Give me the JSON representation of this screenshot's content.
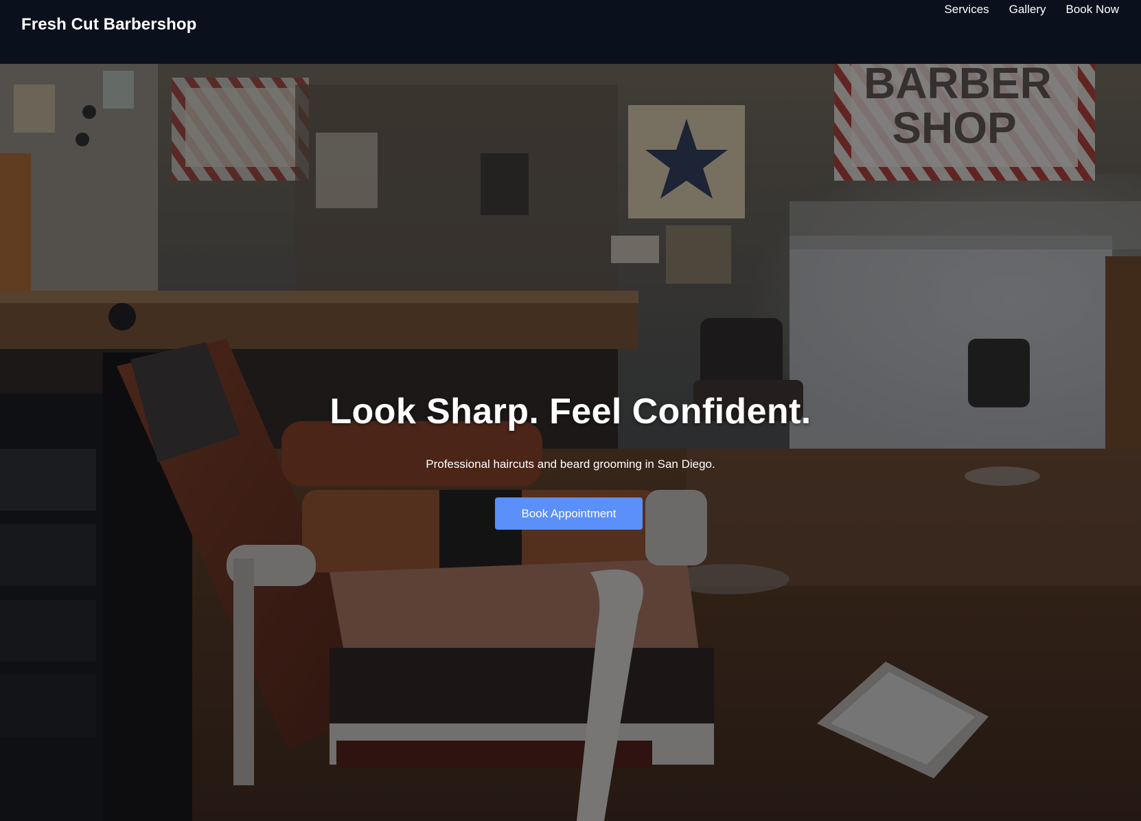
{
  "header": {
    "brand": "Fresh Cut Barbershop",
    "nav": [
      "Services",
      "Gallery",
      "Book Now"
    ]
  },
  "hero": {
    "title": "Look Sharp. Feel Confident.",
    "subtitle": "Professional haircuts and beard grooming in San Diego.",
    "cta_label": "Book Appointment",
    "background": "barbershop interior with barber chairs",
    "wall_sign_text": [
      "BARBER",
      "SHOP"
    ]
  },
  "colors": {
    "header_bg": "#0b111c",
    "accent": "#5b8ff9",
    "text": "#ffffff"
  }
}
